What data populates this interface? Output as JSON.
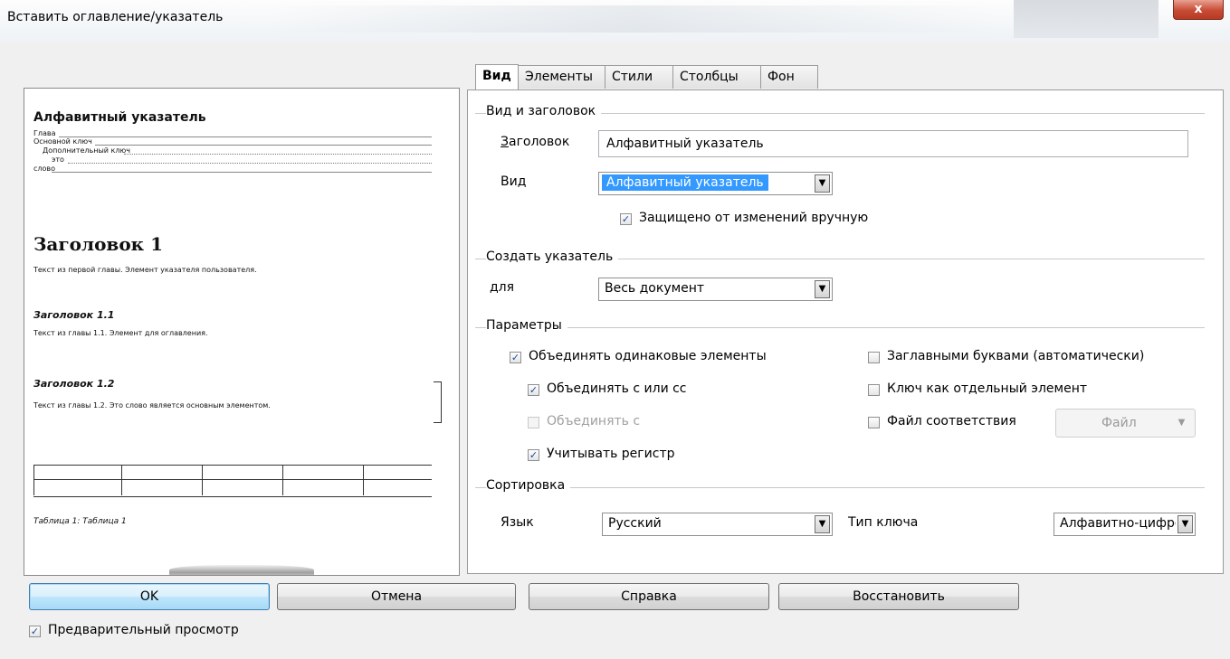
{
  "window": {
    "title": "Вставить оглавление/указатель",
    "close_glyph": "x"
  },
  "preview": {
    "index_title": "Алфавитный указатель",
    "index_entries": [
      "Глава",
      "Основной ключ",
      "Дополнительный ключ",
      "это",
      "слово"
    ],
    "heading1": "Заголовок 1",
    "heading1_text": "Текст из первой главы. Элемент указателя пользователя.",
    "heading11": "Заголовок 1.1",
    "heading11_text": "Текст из главы 1.1. Элемент для оглавления.",
    "heading12": "Заголовок 1.2",
    "heading12_text": "Текст из главы 1.2. Это слово является основным элементом.",
    "table_caption": "Таблица 1: Таблица 1"
  },
  "tabs": [
    {
      "label": "Вид",
      "active": true
    },
    {
      "label": "Элементы",
      "active": false
    },
    {
      "label": "Стили",
      "active": false
    },
    {
      "label": "Столбцы",
      "active": false
    },
    {
      "label": "Фон",
      "active": false
    }
  ],
  "type_title": {
    "group_label": "Вид и заголовок",
    "title_label": "Заголовок",
    "title_value": "Алфавитный указатель",
    "type_label": "Вид",
    "type_value": "Алфавитный указатель",
    "protected_label": "Защищено от изменений вручную",
    "protected_checked": true
  },
  "create_index": {
    "group_label": "Создать указатель",
    "for_label": "для",
    "for_value": "Весь документ"
  },
  "options": {
    "group_label": "Параметры",
    "combine_identical": "Объединять одинаковые элементы",
    "combine_pp": "Объединять с или сс",
    "combine_with": "Объединять с",
    "case_sensitive": "Учитывать регистр",
    "auto_caps": "Заглавными буквами (автоматически)",
    "keys_separate": "Ключ как отдельный элемент",
    "concordance": "Файл соответствия",
    "file_button": "Файл"
  },
  "sort": {
    "group_label": "Сортировка",
    "language_label": "Язык",
    "language_value": "Русский",
    "key_type_label": "Тип ключа",
    "key_type_value": "Алфавитно-цифровой"
  },
  "buttons": {
    "ok": "OK",
    "cancel": "Отмена",
    "help": "Справка",
    "reset": "Восстановить"
  },
  "preview_toggle": {
    "label": "Предварительный просмотр",
    "checked": true
  },
  "colors": {
    "selection": "#3399ff",
    "close": "#c74b35",
    "check": "#1c4a9c"
  }
}
